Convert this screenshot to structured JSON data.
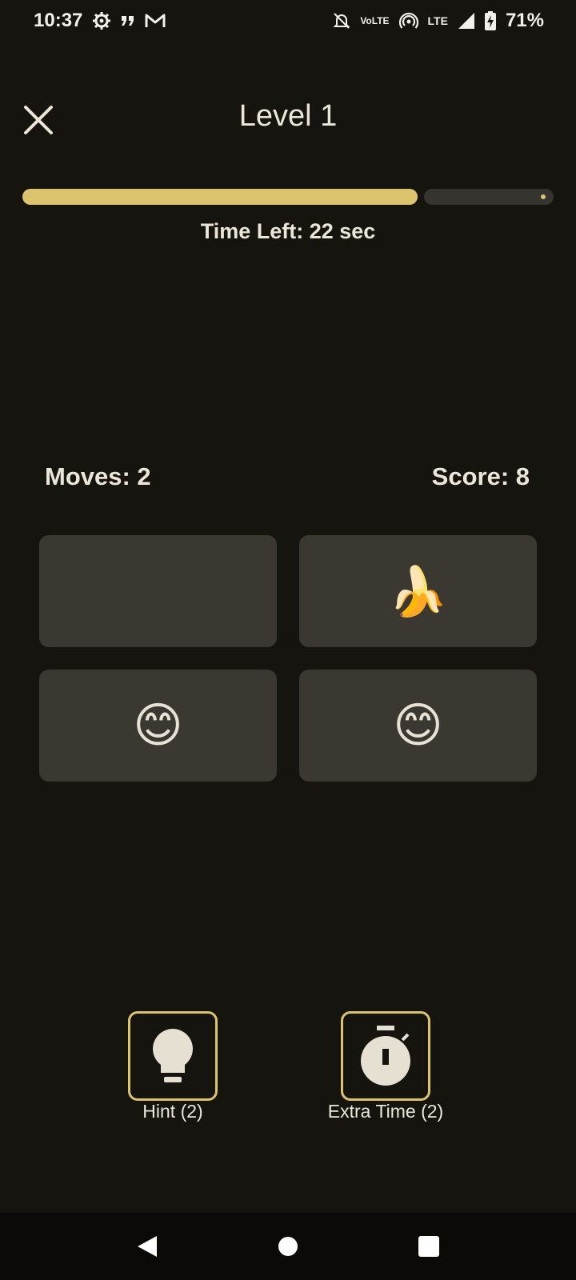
{
  "status_bar": {
    "time": "10:37",
    "left_icons": [
      "settings-icon",
      "quote-icon",
      "gmail-icon"
    ],
    "right_icons": [
      "bell-off-icon",
      "volte-icon",
      "hotspot-icon",
      "lte-icon",
      "signal-icon",
      "battery-charging-icon"
    ],
    "volte_label_top": "Vo",
    "volte_label_bottom": "LTE",
    "lte_label": "LTE",
    "battery": "71%"
  },
  "header": {
    "close_icon": "close-icon",
    "title": "Level 1"
  },
  "timer": {
    "progress_fraction": 0.75,
    "label": "Time Left: 22 sec"
  },
  "stats": {
    "moves": "Moves: 2",
    "score": "Score: 8"
  },
  "cards": [
    {
      "content": "",
      "state": "face-down"
    },
    {
      "content": "🍌",
      "state": "revealed"
    },
    {
      "content": "😊",
      "state": "revealed"
    },
    {
      "content": "😊",
      "state": "revealed"
    }
  ],
  "powerups": {
    "hint": {
      "icon": "lightbulb-icon",
      "label": "Hint (2)"
    },
    "extra_time": {
      "icon": "stopwatch-icon",
      "label": "Extra Time (2)"
    }
  },
  "colors": {
    "background": "#16140f",
    "accent": "#dcc46f",
    "card": "#3a3830",
    "text": "#ece6d8"
  },
  "nav_bar": {
    "icons": [
      "back-icon",
      "home-icon",
      "recents-icon"
    ]
  }
}
